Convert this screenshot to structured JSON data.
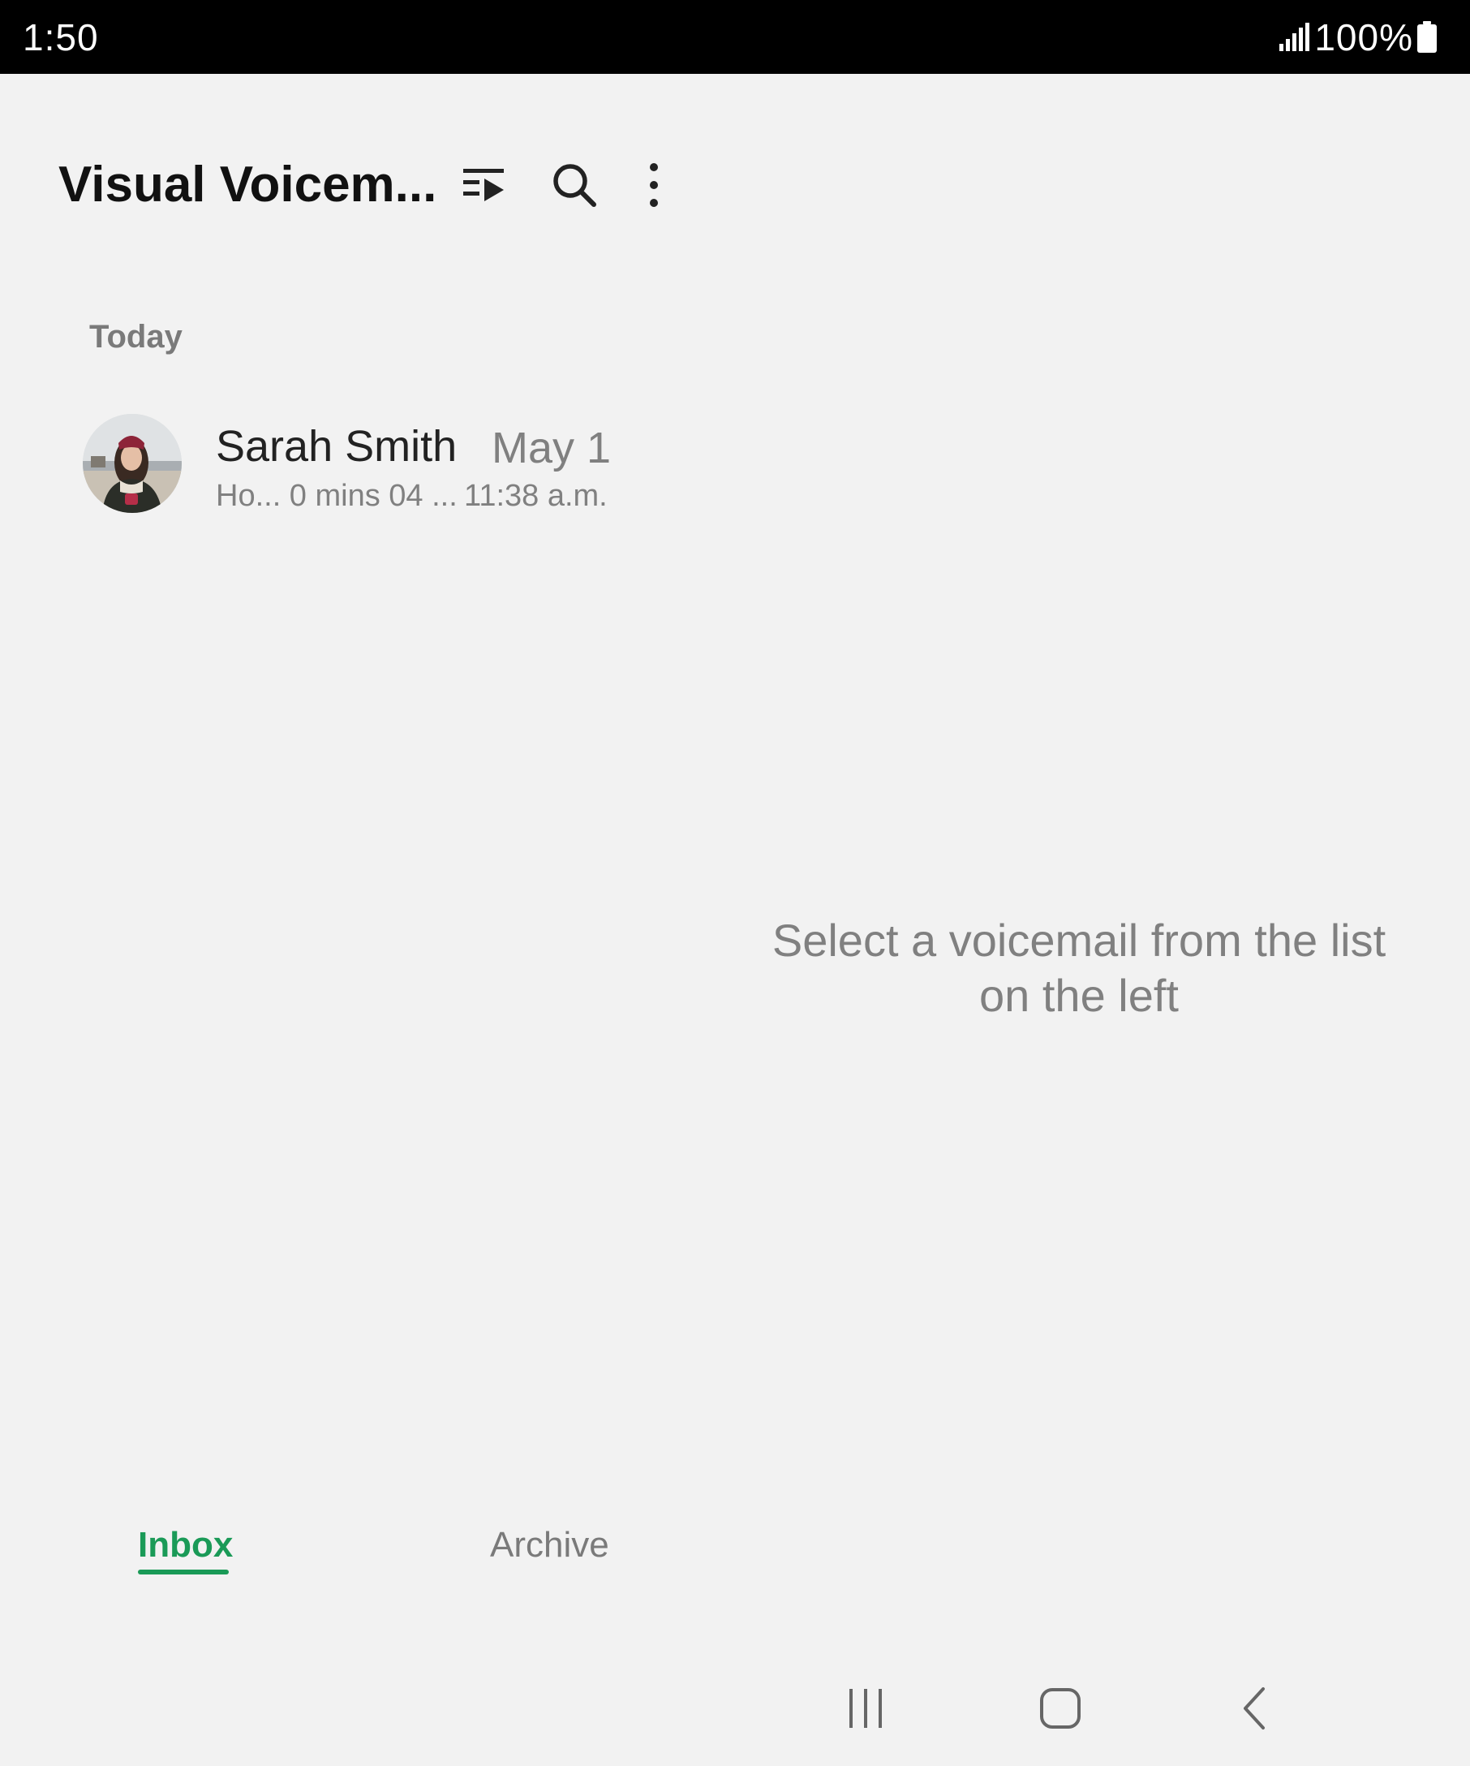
{
  "status_bar": {
    "time": "1:50",
    "battery": "100%",
    "icons": [
      "signal-icon",
      "battery-icon"
    ]
  },
  "app_bar": {
    "title": "Visual Voicem...",
    "icons": [
      "play-list-icon",
      "search-icon",
      "more-options-icon"
    ]
  },
  "list": {
    "section_header": "Today",
    "items": [
      {
        "name": "Sarah Smith",
        "date": "May 1",
        "subtitle": "Ho... 0 mins 04 ...",
        "time": "11:38 a.m."
      }
    ]
  },
  "detail": {
    "empty_message": "Select a voicemail from the list on the left"
  },
  "tabs": [
    {
      "label": "Inbox",
      "selected": true
    },
    {
      "label": "Archive",
      "selected": false
    }
  ],
  "nav_bar": {
    "icons": [
      "recents-icon",
      "home-icon",
      "back-icon"
    ]
  },
  "colors": {
    "background": "#f2f2f2",
    "accent": "#1a9a57",
    "status_bar": "#000000"
  }
}
